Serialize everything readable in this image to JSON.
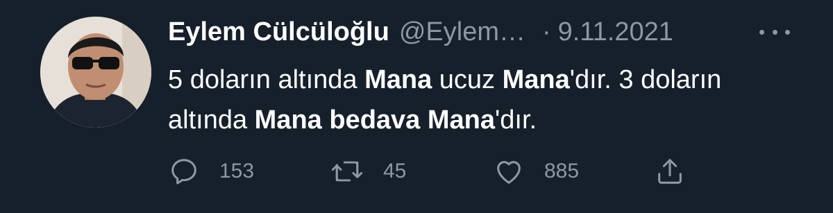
{
  "tweet": {
    "author_name": "Eylem Cülcüloğlu",
    "handle": "@Eylem…",
    "separator": "·",
    "date": "9.11.2021",
    "text_segments": [
      {
        "text": "5 doların altında ",
        "bold": false
      },
      {
        "text": "Mana",
        "bold": true
      },
      {
        "text": " ucuz ",
        "bold": false
      },
      {
        "text": "Mana",
        "bold": true
      },
      {
        "text": "'dır. 3 doların altında ",
        "bold": false
      },
      {
        "text": "Mana bedava Mana",
        "bold": true
      },
      {
        "text": "'dır.",
        "bold": false
      }
    ],
    "actions": {
      "reply": {
        "icon": "reply-icon",
        "count": "153"
      },
      "retweet": {
        "icon": "retweet-icon",
        "count": "45"
      },
      "like": {
        "icon": "heart-icon",
        "count": "885"
      },
      "share": {
        "icon": "share-icon"
      }
    }
  },
  "colors": {
    "background": "#15202b",
    "primary_text": "#ffffff",
    "secondary_text": "#8b98a5"
  }
}
